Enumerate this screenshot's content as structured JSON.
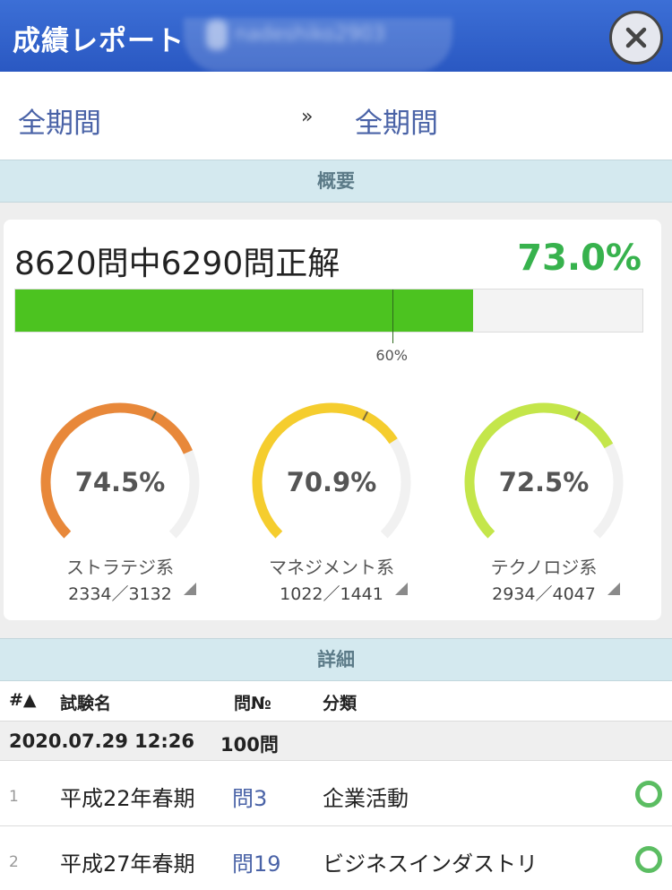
{
  "header": {
    "title": "成績レポート",
    "username": "nadeshiko2903",
    "close_icon": "close-icon"
  },
  "period": {
    "from": "全期間",
    "separator": "»",
    "to": "全期間"
  },
  "summary": {
    "section_title": "概要",
    "score_text": "8620問中6290問正解",
    "score_percent": "73.0%",
    "progress_fraction": 0.73,
    "pass_line_fraction": 0.6,
    "pass_line_label": "60%",
    "gauges": [
      {
        "label": "ストラテジ系",
        "percent": "74.5%",
        "value": 0.745,
        "count": "2334／3132",
        "color": "#e8883a"
      },
      {
        "label": "マネジメント系",
        "percent": "70.9%",
        "value": 0.709,
        "count": "1022／1441",
        "color": "#f5cd2e"
      },
      {
        "label": "テクノロジ系",
        "percent": "72.5%",
        "value": 0.725,
        "count": "2934／4047",
        "color": "#c4e64a"
      }
    ]
  },
  "detail": {
    "section_title": "詳細",
    "columns": {
      "no": "#▲",
      "exam": "試験名",
      "q": "問№",
      "category": "分類"
    },
    "session": {
      "datetime": "2020.07.29 12:26",
      "count": "100問"
    },
    "rows": [
      {
        "no": "1",
        "exam": "平成22年春期",
        "q": "問3",
        "category": "企業活動",
        "result": "correct"
      },
      {
        "no": "2",
        "exam": "平成27年春期",
        "q": "問19",
        "category": "ビジネスインダストリ",
        "result": "correct"
      }
    ]
  },
  "colors": {
    "header": "#2a58c2",
    "accent_green": "#4cc320",
    "link": "#4a63a7"
  }
}
